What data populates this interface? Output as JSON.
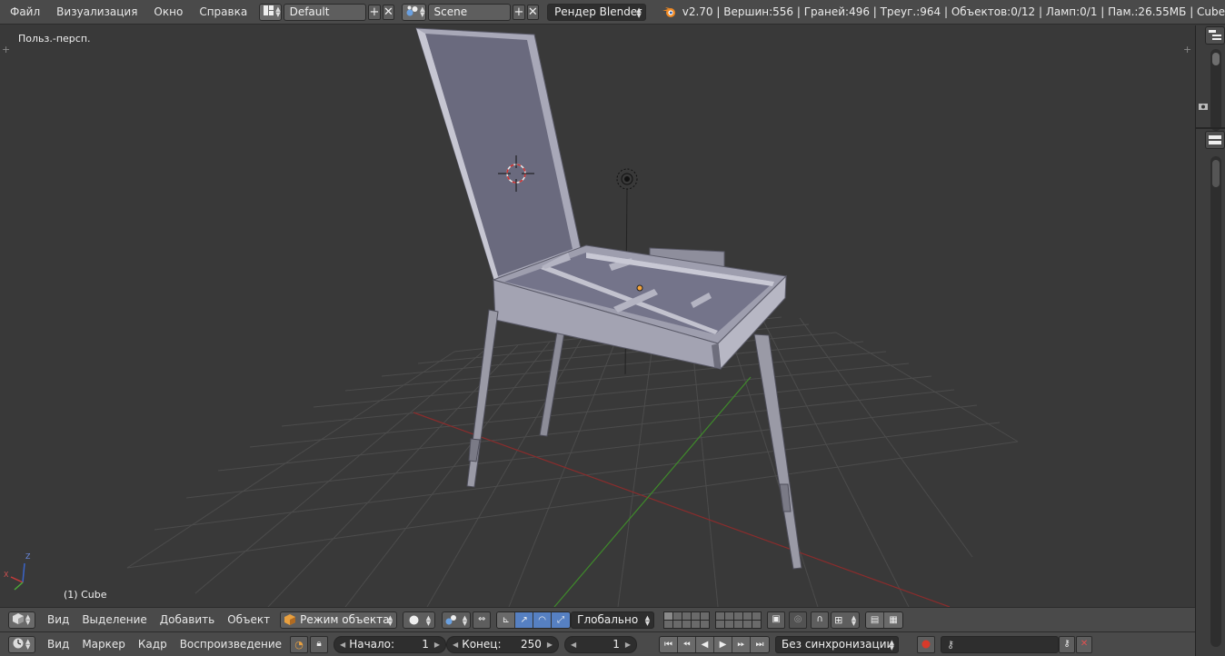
{
  "top_menu": [
    "Файл",
    "Визуализация",
    "Окно",
    "Справка"
  ],
  "screen_layout": "Default",
  "scene": "Scene",
  "render_engine": "Рендер Blender",
  "stats": "v2.70 | Вершин:556 | Граней:496 | Треуг.:964 | Объектов:0/12 | Ламп:0/1 | Пам.:26.55МБ | Cube",
  "viewport": {
    "view_label": "Польз.-персп.",
    "object_label": "(1) Cube",
    "axis_z": "Z",
    "axis_x": "X"
  },
  "view3d_header": {
    "menus": [
      "Вид",
      "Выделение",
      "Добавить",
      "Объект"
    ],
    "mode": "Режим объекта",
    "orientation": "Глобально"
  },
  "timeline_header": {
    "menus": [
      "Вид",
      "Маркер",
      "Кадр",
      "Воспроизведение"
    ],
    "start_label": "Начало:",
    "start_value": "1",
    "end_label": "Конец:",
    "end_value": "250",
    "current_frame": "1",
    "sync": "Без синхронизации"
  },
  "colors": {
    "header_bg": "#4a4a4a",
    "viewport_bg": "#393939",
    "grid_line": "#4b4b4b",
    "x_axis": "#8b2c2c",
    "y_axis": "#3f8a2b",
    "model_light": "#a3a3b3",
    "model_dark": "#6a6a7c",
    "accent_blue": "#5680c2",
    "origin_orange": "#f4a43a"
  }
}
